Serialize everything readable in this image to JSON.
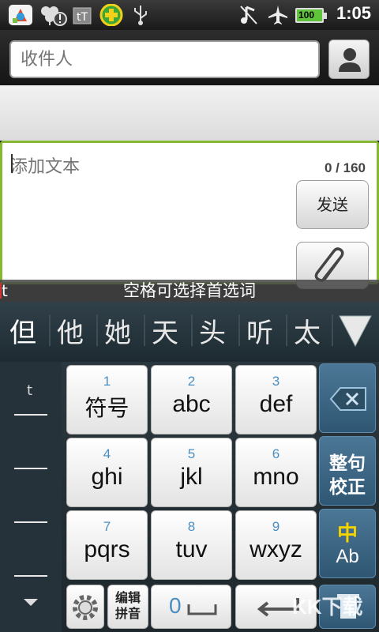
{
  "status_bar": {
    "time": "1:05",
    "battery_label": "100",
    "icons": [
      "appstore-icon",
      "clover-warning-icon",
      "tt-icon",
      "plus-circle-icon",
      "usb-icon",
      "music-off-icon",
      "airplane-icon",
      "battery-icon"
    ]
  },
  "recipient": {
    "placeholder": "收件人",
    "contact_icon": "person-icon"
  },
  "compose": {
    "placeholder": "添加文本",
    "counter": "0 / 160",
    "send_label": "发送",
    "attach_icon": "paperclip-icon"
  },
  "hint": {
    "text": "空格可选择首选词",
    "typed": "t"
  },
  "candidates": [
    "但",
    "他",
    "她",
    "天",
    "头",
    "听",
    "太"
  ],
  "keyboard": {
    "left_typed": "t",
    "keys": [
      {
        "num": "1",
        "label": "符号"
      },
      {
        "num": "2",
        "label": "abc"
      },
      {
        "num": "3",
        "label": "def"
      },
      {
        "num": "4",
        "label": "ghi"
      },
      {
        "num": "5",
        "label": "jkl"
      },
      {
        "num": "6",
        "label": "mno"
      },
      {
        "num": "7",
        "label": "pqrs"
      },
      {
        "num": "8",
        "label": "tuv"
      },
      {
        "num": "9",
        "label": "wxyz"
      }
    ],
    "side": {
      "correct_line1": "整句",
      "correct_line2": "校正",
      "mode_line1": "中",
      "mode_line2": "Ab"
    },
    "bottom": {
      "edit_line1": "编辑",
      "edit_line2": "拼音",
      "zero_label": "0"
    }
  },
  "watermark": "KK下载",
  "colors": {
    "accent_green": "#86b933",
    "number_blue": "#4a8ec0",
    "side_key_blue": "#3d6a8a",
    "mode_yellow": "#f2d200"
  }
}
